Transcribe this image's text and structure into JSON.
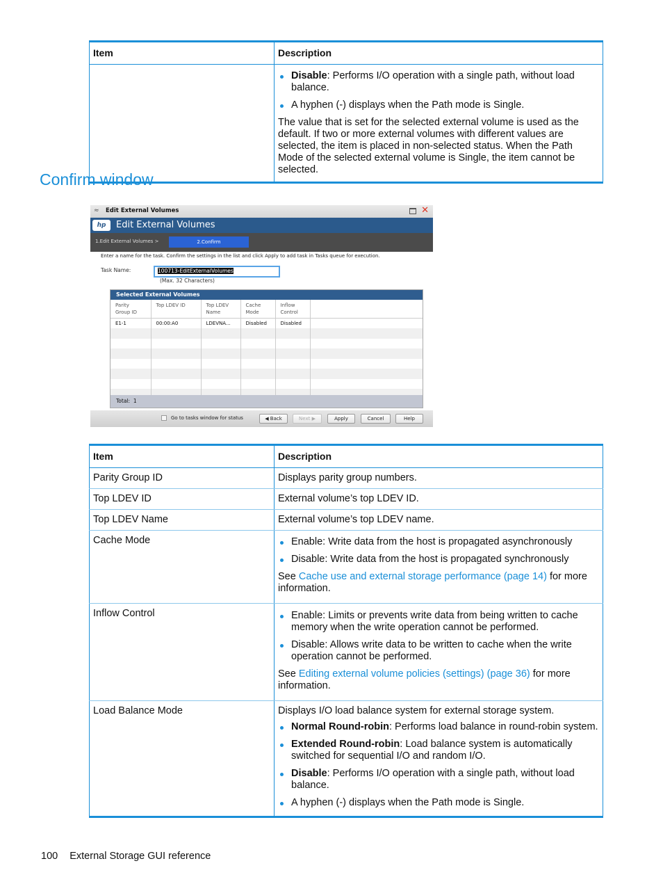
{
  "table1": {
    "headers": [
      "Item",
      "Description"
    ],
    "row": {
      "item": "",
      "bullets": [
        {
          "bold": "Disable",
          "text": ": Performs I/O operation with a single path, without load balance."
        },
        {
          "bold": "",
          "text": "A hyphen (-) displays when the Path mode is Single."
        }
      ],
      "paragraph": "The value that is set for the selected external volume is used as the default. If two or more external volumes with different values are selected, the item is placed in non-selected status. When the Path Mode of the selected external volume is Single, the item cannot be selected."
    }
  },
  "section_title": "Confirm window",
  "window": {
    "titlebar": "Edit External Volumes",
    "header": "Edit External Volumes",
    "logo": "hp",
    "steps": {
      "step1": "1.Edit External Volumes  >",
      "step2": "2.Confirm"
    },
    "instructions": "Enter a name for the task. Confirm the settings in the list and click Apply to add task in Tasks queue for execution.",
    "task_name_label": "Task Name:",
    "task_name_value": "100713-EditExternalVolumes",
    "task_name_hint": "(Max. 32 Characters)",
    "panel_title": "Selected External Volumes",
    "columns": [
      [
        "Parity",
        "Group ID"
      ],
      [
        "Top LDEV ID",
        ""
      ],
      [
        "Top LDEV",
        "Name"
      ],
      [
        "Cache",
        "Mode"
      ],
      [
        "Inflow",
        "Control"
      ]
    ],
    "rows": [
      [
        "E1-1",
        "00:00:A0",
        "LDEVNA...",
        "Disabled",
        "Disabled"
      ]
    ],
    "total_label": "Total:",
    "total_value": "1",
    "checkbox_label": "Go to tasks window for status",
    "buttons": {
      "back": "◀ Back",
      "next": "Next ▶",
      "apply": "Apply",
      "cancel": "Cancel",
      "help": "Help"
    }
  },
  "table2": {
    "headers": [
      "Item",
      "Description"
    ],
    "rows": [
      {
        "item": "Parity Group ID",
        "desc": "Displays parity group numbers."
      },
      {
        "item": "Top LDEV ID",
        "desc": "External volume’s top LDEV ID."
      },
      {
        "item": "Top LDEV Name",
        "desc": "External volume’s top LDEV name."
      },
      {
        "item": "Cache Mode",
        "bullets": [
          "Enable: Write data from the host is propagated asynchronously",
          "Disable: Write data from the host is propagated synchronously"
        ],
        "see_pre": "See ",
        "see_link": "Cache use and external storage performance (page 14)",
        "see_post": " for more information."
      },
      {
        "item": "Inflow Control",
        "bullets": [
          "Enable: Limits or prevents write data from being written to cache memory when the write operation cannot be performed.",
          "Disable: Allows write data to be written to cache when the write operation cannot be performed."
        ],
        "see_pre": "See ",
        "see_link": "Editing external volume policies (settings) (page 36)",
        "see_post": " for more information."
      },
      {
        "item": "Load Balance Mode",
        "intro": "Displays I/O load balance system for external storage system.",
        "bullets": [
          {
            "bold": "Normal Round-robin",
            "text": ": Performs load balance in round-robin system."
          },
          {
            "bold": "Extended Round-robin",
            "text": ": Load balance system is automatically switched for sequential I/O and random I/O."
          },
          {
            "bold": "Disable",
            "text": ": Performs I/O operation with a single path, without load balance."
          },
          {
            "bold": "",
            "text": "A hyphen (-) displays when the Path mode is Single."
          }
        ]
      }
    ]
  },
  "footer": {
    "page_number": "100",
    "section": "External Storage GUI reference"
  },
  "colors": {
    "accent": "#1a8fd8",
    "window_header": "#2b5a8c",
    "step_active": "#2b63d4"
  }
}
